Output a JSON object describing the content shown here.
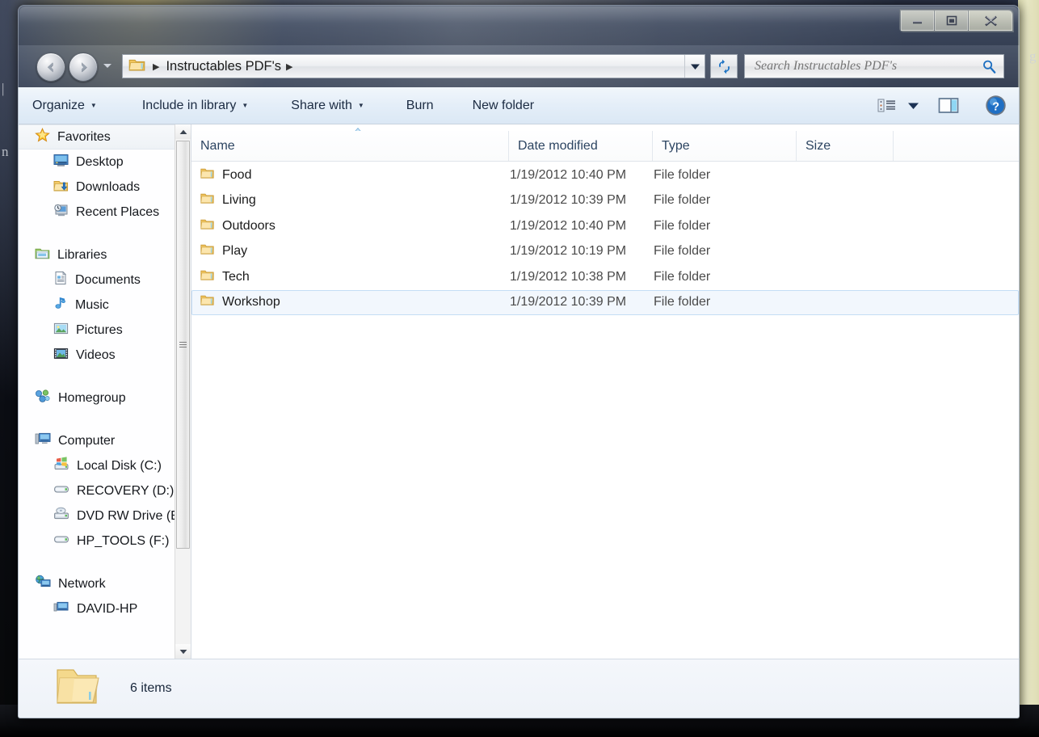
{
  "window": {
    "controls": {
      "minimize_label": "Minimize",
      "maximize_label": "Restore Down",
      "close_label": "Close"
    }
  },
  "navigation": {
    "back_label": "Back",
    "forward_label": "Forward",
    "recent_pages_label": "Recent Pages",
    "breadcrumb": {
      "folder_icon": "folder-icon",
      "path_label": "Instructables PDF's",
      "leading_separator": "▶",
      "trailing_separator": "▶"
    },
    "address_dropdown_label": "Previous Locations",
    "refresh_label": "Refresh"
  },
  "search": {
    "placeholder": "Search Instructables PDF's",
    "value": "",
    "icon": "search-icon"
  },
  "toolbar": {
    "items": [
      {
        "label": "Organize",
        "has_caret": true
      },
      {
        "label": "Include in library",
        "has_caret": true
      },
      {
        "label": "Share with",
        "has_caret": true
      },
      {
        "label": "Burn",
        "has_caret": false
      },
      {
        "label": "New folder",
        "has_caret": false
      }
    ],
    "caret_glyph": "▼",
    "view_button_label": "Change your view",
    "view_caret_label": "More options",
    "preview_pane_label": "Show the preview pane",
    "help_label": "Get help",
    "help_glyph": "?"
  },
  "navpane": {
    "sections": [
      {
        "name": "Favorites",
        "icon": "star-icon",
        "highlighted": true,
        "children": [
          {
            "label": "Desktop",
            "icon": "desktop-icon"
          },
          {
            "label": "Downloads",
            "icon": "downloads-folder-icon"
          },
          {
            "label": "Recent Places",
            "icon": "recent-places-icon"
          }
        ]
      },
      {
        "name": "Libraries",
        "icon": "libraries-icon",
        "highlighted": false,
        "children": [
          {
            "label": "Documents",
            "icon": "documents-icon"
          },
          {
            "label": "Music",
            "icon": "music-note-icon"
          },
          {
            "label": "Pictures",
            "icon": "pictures-icon"
          },
          {
            "label": "Videos",
            "icon": "videos-icon"
          }
        ]
      },
      {
        "name": "Homegroup",
        "icon": "homegroup-icon",
        "highlighted": false,
        "children": []
      },
      {
        "name": "Computer",
        "icon": "computer-icon",
        "highlighted": false,
        "children": [
          {
            "label": "Local Disk (C:)",
            "icon": "windows-drive-icon"
          },
          {
            "label": "RECOVERY (D:)",
            "icon": "drive-icon"
          },
          {
            "label": "DVD RW Drive (E:",
            "icon": "dvd-drive-icon"
          },
          {
            "label": "HP_TOOLS (F:)",
            "icon": "drive-icon"
          }
        ]
      },
      {
        "name": "Network",
        "icon": "network-icon",
        "highlighted": false,
        "children": [
          {
            "label": "DAVID-HP",
            "icon": "network-computer-icon"
          }
        ]
      }
    ],
    "scrollbar": {
      "up_label": "Scroll up",
      "down_label": "Scroll down",
      "thumb_label": "Scroll position"
    }
  },
  "filelist": {
    "sort_column": "Name",
    "sort_direction": "ascending",
    "columns": [
      {
        "key": "name",
        "label": "Name"
      },
      {
        "key": "date",
        "label": "Date modified"
      },
      {
        "key": "type",
        "label": "Type"
      },
      {
        "key": "size",
        "label": "Size"
      }
    ],
    "rows": [
      {
        "name": "Food",
        "date": "1/19/2012 10:40 PM",
        "type": "File folder",
        "size": "",
        "selected": false
      },
      {
        "name": "Living",
        "date": "1/19/2012 10:39 PM",
        "type": "File folder",
        "size": "",
        "selected": false
      },
      {
        "name": "Outdoors",
        "date": "1/19/2012 10:40 PM",
        "type": "File folder",
        "size": "",
        "selected": false
      },
      {
        "name": "Play",
        "date": "1/19/2012 10:19 PM",
        "type": "File folder",
        "size": "",
        "selected": false
      },
      {
        "name": "Tech",
        "date": "1/19/2012 10:38 PM",
        "type": "File folder",
        "size": "",
        "selected": false
      },
      {
        "name": "Workshop",
        "date": "1/19/2012 10:39 PM",
        "type": "File folder",
        "size": "",
        "selected": true
      }
    ]
  },
  "statusbar": {
    "icon": "large-folder-icon",
    "item_count_text": "6 items"
  },
  "colors": {
    "selection_fill": "#f2f7fd",
    "selection_border": "#c4ddf5",
    "folder_body": "#fcd77f",
    "folder_edge": "#d9a63c",
    "column_header_text": "#2c4461",
    "toolbar_text": "#1b2b42",
    "accent_blue": "#1f6fc4"
  }
}
